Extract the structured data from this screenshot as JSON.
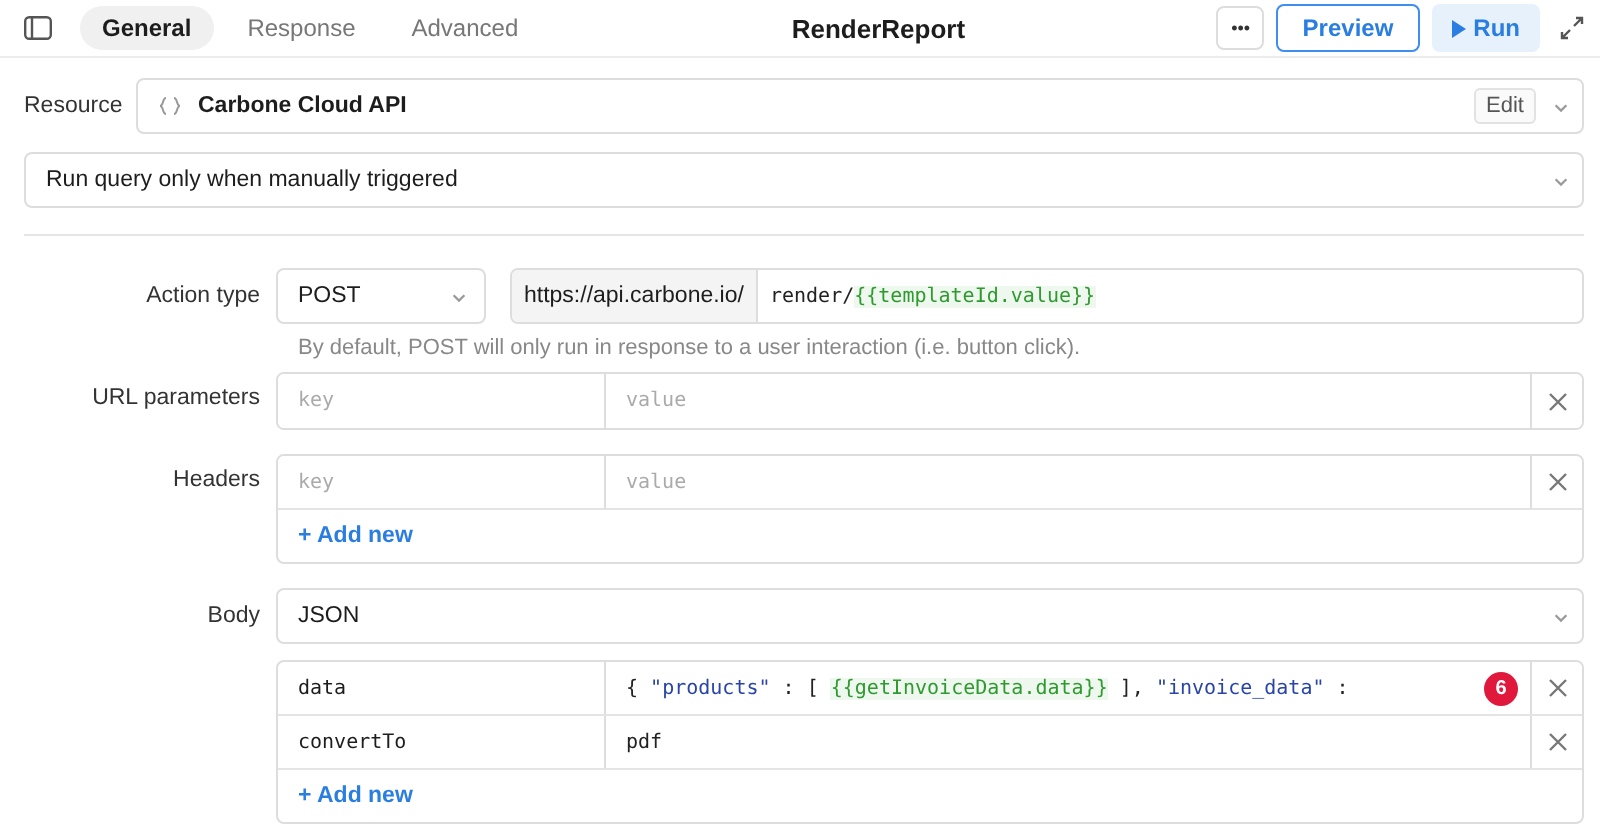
{
  "header": {
    "tabs": [
      {
        "label": "General",
        "selected": true
      },
      {
        "label": "Response",
        "selected": false
      },
      {
        "label": "Advanced",
        "selected": false
      }
    ],
    "title": "RenderReport",
    "more": "•••",
    "preview": "Preview",
    "run": "Run"
  },
  "resource": {
    "label": "Resource",
    "value": "Carbone Cloud API",
    "edit": "Edit"
  },
  "trigger": {
    "value": "Run query only when manually triggered"
  },
  "action": {
    "label": "Action type",
    "method": "POST",
    "base_url": "https://api.carbone.io/",
    "path": [
      {
        "kind": "plain",
        "text": "render/"
      },
      {
        "kind": "template",
        "text": "{{templateId.value}}"
      }
    ],
    "hint": "By default, POST will only run in response to a user interaction (i.e. button click)."
  },
  "url_parameters": {
    "label": "URL parameters",
    "rows": [
      {
        "key_placeholder": "key",
        "value_placeholder": "value"
      }
    ]
  },
  "headers": {
    "label": "Headers",
    "rows": [
      {
        "key_placeholder": "key",
        "value_placeholder": "value"
      }
    ],
    "add": "+ Add new"
  },
  "body": {
    "label": "Body",
    "type": "JSON",
    "rows": [
      {
        "key": "data",
        "value": [
          {
            "kind": "plain",
            "text": "{ "
          },
          {
            "kind": "string",
            "text": "\"products\""
          },
          {
            "kind": "plain",
            "text": " : [ "
          },
          {
            "kind": "template",
            "text": "{{getInvoiceData.data}}"
          },
          {
            "kind": "plain",
            "text": " ], "
          },
          {
            "kind": "string",
            "text": "\"invoice_data\""
          },
          {
            "kind": "plain",
            "text": " :"
          }
        ],
        "badge": "6"
      },
      {
        "key": "convertTo",
        "value": [
          {
            "kind": "plain",
            "text": "pdf"
          }
        ]
      }
    ],
    "add": "+ Add new"
  }
}
